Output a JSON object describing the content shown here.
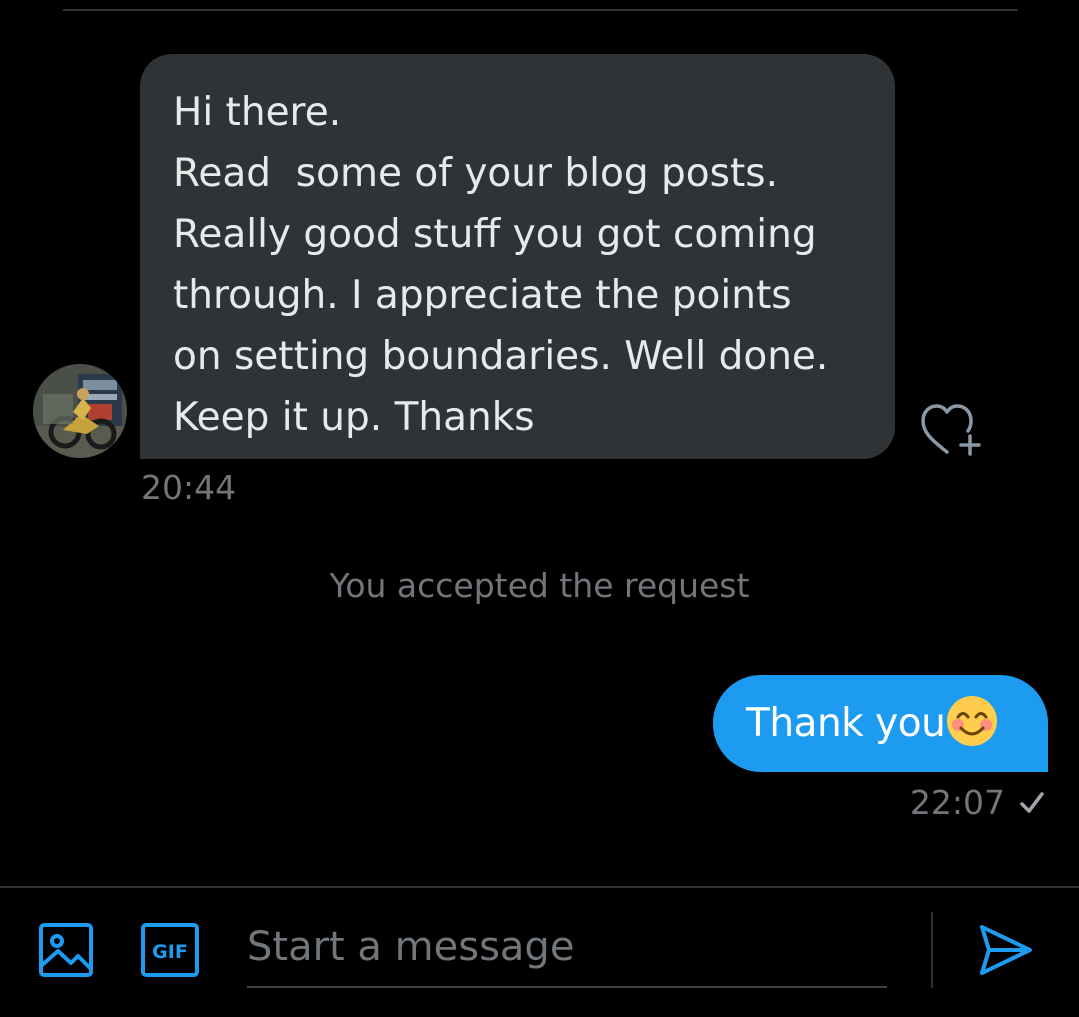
{
  "conversation": {
    "received": {
      "lines": [
        "Hi there.",
        "Read  some of your blog posts.",
        "Really good stuff you got coming",
        "through. I appreciate the points",
        "on setting boundaries. Well done.",
        "Keep it up. Thanks"
      ],
      "time": "20:44",
      "avatar_icon": "user-avatar-motorcycle"
    },
    "system_message": "You accepted the request",
    "sent": {
      "text": "Thank you",
      "emoji": "smiling-face-with-smiling-eyes",
      "time": "22:07",
      "status_icon": "check-icon"
    }
  },
  "composer": {
    "placeholder": "Start a message",
    "media_icon": "image-icon",
    "gif_label": "GIF",
    "send_icon": "send-icon"
  },
  "colors": {
    "background": "#000000",
    "received_bubble": "#2f3336",
    "sent_bubble": "#1d9bf0",
    "muted_text": "#71767b",
    "accent": "#1d9bf0"
  }
}
